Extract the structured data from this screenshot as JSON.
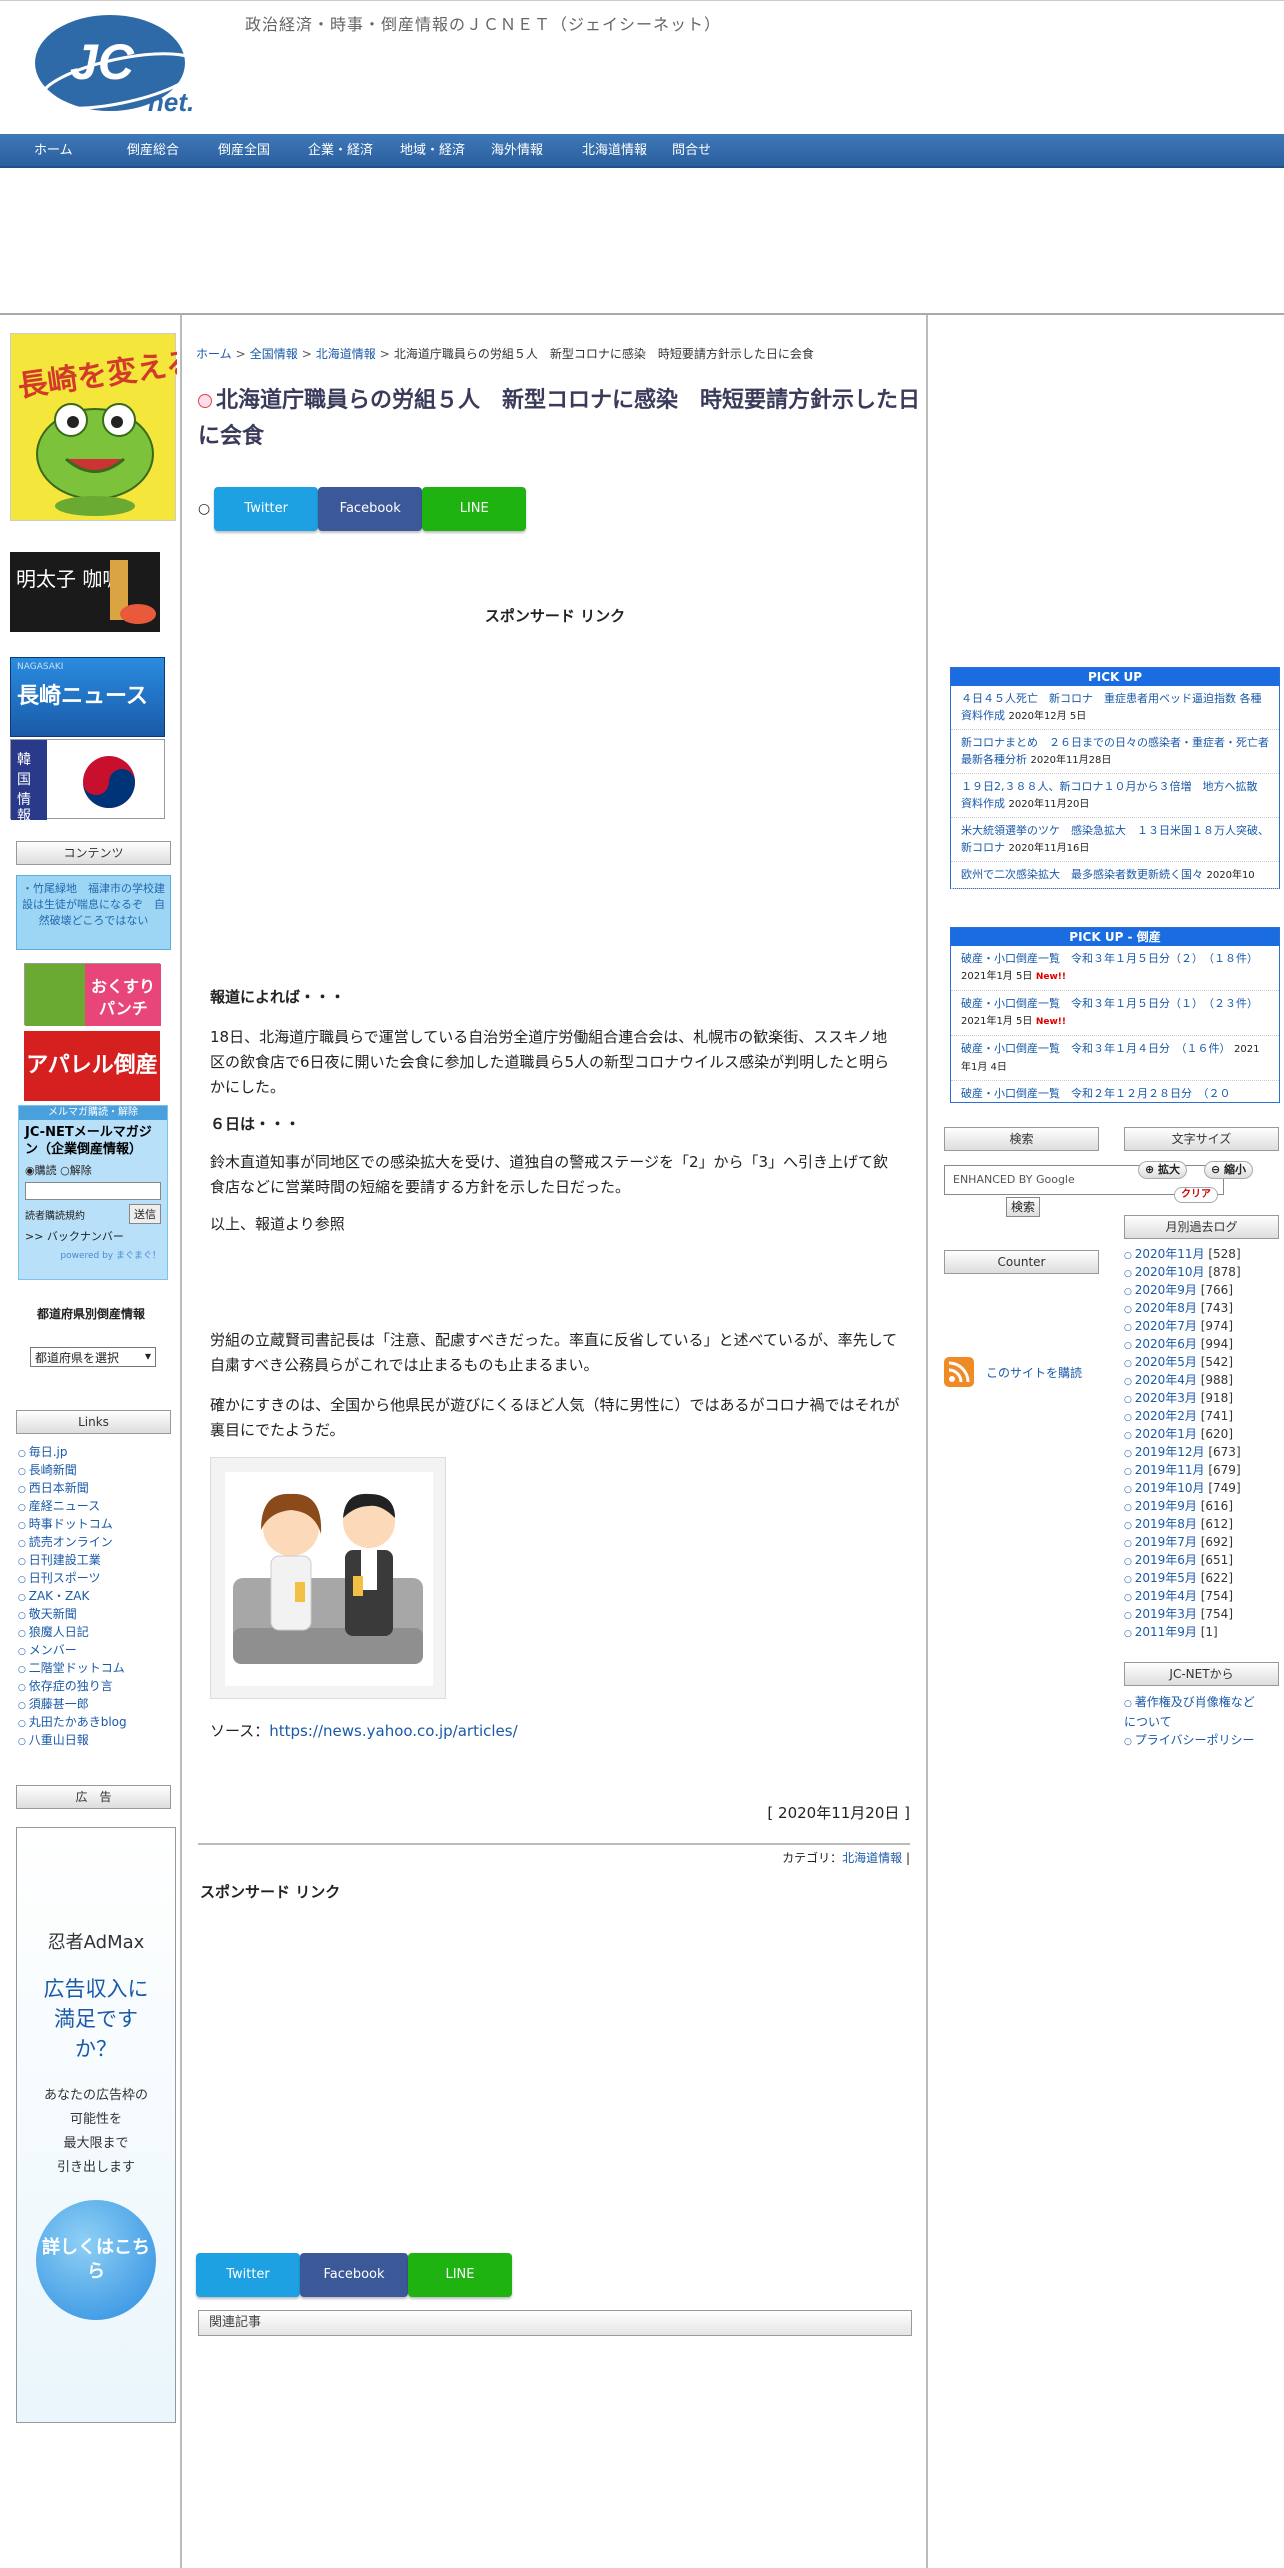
{
  "header": {
    "tagline": "政治経済・時事・倒産情報のＪＣＮＥＴ（ジェイシーネット）",
    "logo_text_jc": "JC",
    "logo_text_net": "net."
  },
  "nav": [
    "ホーム",
    "倒産総合",
    "倒産全国",
    "企業・経済",
    "地域・経済",
    "海外情報",
    "北海道情報",
    "問合せ"
  ],
  "left": {
    "banner_frog": "長崎を変える",
    "banner_mentaiko": "明太子 咖喱",
    "banner_nagasaki_small": "NAGASAKI",
    "banner_nagasaki": "長崎ニュース",
    "banner_korea": "韓国情報",
    "contents_head": "コンテンツ",
    "contents_text": "・竹尾緑地　福津市の学校建設は生徒が喘息になるぞ　自然破壊どころではない",
    "banner_okusuri": "おくすりパンチ",
    "banner_apparel": "アパレル倒産",
    "mag": {
      "top": "メルマガ購読・解除",
      "title": "JC-NETメールマガジン（企業倒産情報）",
      "radio_subscribe": "購読",
      "radio_cancel": "解除",
      "terms": "読者購読規約",
      "submit": "送信",
      "back": ">> バックナンバー",
      "powered": "powered by まぐまぐ！"
    },
    "pref_title": "都道府県別倒産情報",
    "pref_select": "都道府県を選択",
    "links_head": "Links",
    "links": [
      "毎日.jp",
      "長崎新聞",
      "西日本新聞",
      "産経ニュース",
      "時事ドットコム",
      "読売オンライン",
      "日刊建設工業",
      "日刊スポーツ",
      "ZAK・ZAK",
      "敬天新聞",
      "狼魔人日記",
      "メンバー",
      "二階堂ドットコム",
      "依存症の独り言",
      "須藤甚一郎",
      "丸田たかあきblog",
      "八重山日報"
    ],
    "ad_head": "広　告",
    "admax": {
      "brand": "忍者AdMax",
      "headline": "広告収入に満足ですか？",
      "body": [
        "あなたの広告枠の",
        "可能性を",
        "最大限まで",
        "引き出します"
      ],
      "cta": "詳しくはこちら"
    }
  },
  "main": {
    "breadcrumb": [
      "ホーム",
      "全国情報",
      "北海道情報",
      "北海道庁職員らの労組５人　新型コロナに感染　時短要請方針示した日に会食"
    ],
    "title": "北海道庁職員らの労組５人　新型コロナに感染　時短要請方針示した日に会食",
    "share": {
      "twitter": "Twitter",
      "facebook": "Facebook",
      "line": "LINE"
    },
    "sponsor": "スポンサード リンク",
    "p_heading1": "報道によれば・・・",
    "p1": "18日、北海道庁職員らで運営している自治労全道庁労働組合連合会は、札幌市の歓楽街、ススキノ地区の飲食店で6日夜に開いた会食に参加した道職員ら5人の新型コロナウイルス感染が判明したと明らかにした。",
    "p_heading2": "６日は・・・",
    "p2": "鈴木直道知事が同地区での感染拡大を受け、道独自の警戒ステージを「2」から「3」へ引き上げて飲食店などに営業時間の短縮を要請する方針を示した日だった。",
    "p3": "以上、報道より参照",
    "p4": "労組の立蔵賢司書記長は「注意、配慮すべきだった。率直に反省している」と述べているが、率先して自粛すべき公務員らがこれでは止まるものも止まるまい。",
    "p5": "確かにすきのは、全国から他県民が遊びにくるほど人気（特に男性に）ではあるがコロナ禍ではそれが裏目にでたようだ。",
    "source_label": "ソース：",
    "source_url": "https://news.yahoo.co.jp/articles/",
    "date": "[ 2020年11月20日 ]",
    "category_label": "カテゴリ：",
    "category": "北海道情報",
    "sponsor2": "スポンサード リンク",
    "related": "関連記事"
  },
  "right": {
    "pickup_head": "PICK UP",
    "pickup": [
      {
        "title": "４日４５人死亡　新コロナ　重症患者用ベッド逼迫指数 各種資料作成",
        "date": "2020年12月 5日"
      },
      {
        "title": "新コロナまとめ　２６日までの日々の感染者・重症者・死亡者　最新各種分析",
        "date": "2020年11月28日"
      },
      {
        "title": "１９日2,３８８人、新コロナ１０月から３倍増　地方へ拡散 資料作成",
        "date": "2020年11月20日"
      },
      {
        "title": "米大統領選挙のツケ　感染急拡大　１３日米国１８万人突破、新コロナ",
        "date": "2020年11月16日"
      },
      {
        "title": "欧州で二次感染拡大　最多感染者数更新続く国々",
        "date": "2020年10"
      }
    ],
    "pickup2_head": "PICK UP - 倒産",
    "pickup2": [
      {
        "title": "破産・小口倒産一覧　令和３年１月５日分（２）　（１８件）",
        "date": "2021年1月 5日",
        "new": "New!!"
      },
      {
        "title": "破産・小口倒産一覧　令和３年１月５日分（１）　（２３件）",
        "date": "2021年1月 5日",
        "new": "New!!"
      },
      {
        "title": "破産・小口倒産一覧　令和３年１月４日分　（１６件）",
        "date": "2021年1月 4日",
        "new": ""
      },
      {
        "title": "破産・小口倒産一覧　令和２年１２月２８日分　（２０",
        "date": "",
        "new": ""
      }
    ],
    "search_head": "検索",
    "search_placeholder": "ENHANCED BY Google",
    "search_btn": "検索",
    "font_head": "文字サイズ",
    "font_big": "拡大",
    "font_small": "縮小",
    "font_clear": "クリア",
    "counter_head": "Counter",
    "archive_head": "月別過去ログ",
    "archive": [
      {
        "month": "2020年11月",
        "count": "[528]"
      },
      {
        "month": "2020年10月",
        "count": "[878]"
      },
      {
        "month": "2020年9月",
        "count": "[766]"
      },
      {
        "month": "2020年8月",
        "count": "[743]"
      },
      {
        "month": "2020年7月",
        "count": "[974]"
      },
      {
        "month": "2020年6月",
        "count": "[994]"
      },
      {
        "month": "2020年5月",
        "count": "[542]"
      },
      {
        "month": "2020年4月",
        "count": "[988]"
      },
      {
        "month": "2020年3月",
        "count": "[918]"
      },
      {
        "month": "2020年2月",
        "count": "[741]"
      },
      {
        "month": "2020年1月",
        "count": "[620]"
      },
      {
        "month": "2019年12月",
        "count": "[673]"
      },
      {
        "month": "2019年11月",
        "count": "[679]"
      },
      {
        "month": "2019年10月",
        "count": "[749]"
      },
      {
        "month": "2019年9月",
        "count": "[616]"
      },
      {
        "month": "2019年8月",
        "count": "[612]"
      },
      {
        "month": "2019年7月",
        "count": "[692]"
      },
      {
        "month": "2019年6月",
        "count": "[651]"
      },
      {
        "month": "2019年5月",
        "count": "[622]"
      },
      {
        "month": "2019年4月",
        "count": "[754]"
      },
      {
        "month": "2019年3月",
        "count": "[754]"
      },
      {
        "month": "2011年9月",
        "count": "[1]"
      }
    ],
    "rss_label": "このサイトを購読",
    "jc_head": "JC-NETから",
    "jc_links": [
      "著作権及び肖像権などについて",
      "プライバシーポリシー"
    ]
  },
  "colors": {
    "nav_bg": "#2f6aa8",
    "link": "#1a5aa8",
    "pickup_head": "#1a6ce0",
    "twitter": "#1da1e2",
    "facebook": "#3b5998",
    "line": "#1fb312"
  }
}
